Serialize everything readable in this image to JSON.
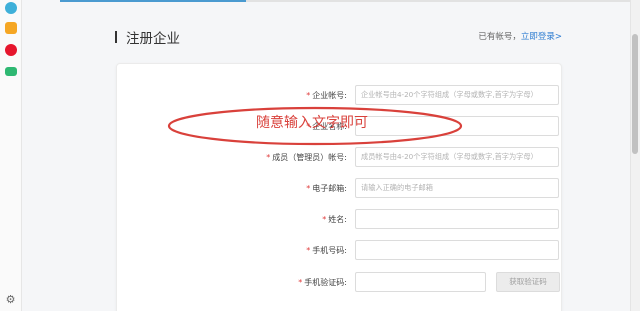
{
  "header": {
    "title": "注册企业",
    "login_prompt": "已有帐号，",
    "login_link": "立即登录>"
  },
  "form": {
    "fields": [
      {
        "label": "企业帐号:",
        "placeholder": "企业帐号由4-20个字符组成（字母或数字,首字为字母）"
      },
      {
        "label": "企业名称:",
        "placeholder": ""
      },
      {
        "label": "成员（管理员）帐号:",
        "placeholder": "成员帐号由4-20个字符组成（字母或数字,首字为字母）"
      },
      {
        "label": "电子邮箱:",
        "placeholder": "请输入正确的电子邮箱"
      },
      {
        "label": "姓名:",
        "placeholder": ""
      },
      {
        "label": "手机号码:",
        "placeholder": ""
      },
      {
        "label": "手机验证码:",
        "placeholder": ""
      }
    ],
    "required_mark": "*",
    "get_code_button": "获取验证码"
  },
  "annotation": {
    "text": "随意输入文字即可",
    "color": "#d9413b"
  },
  "colors": {
    "accent": "#2f7dd1",
    "required": "#e03c3c"
  },
  "sidebar_icons": [
    "chat-bubble-icon",
    "star-icon",
    "weibo-icon",
    "folder-icon",
    "gear-icon"
  ]
}
